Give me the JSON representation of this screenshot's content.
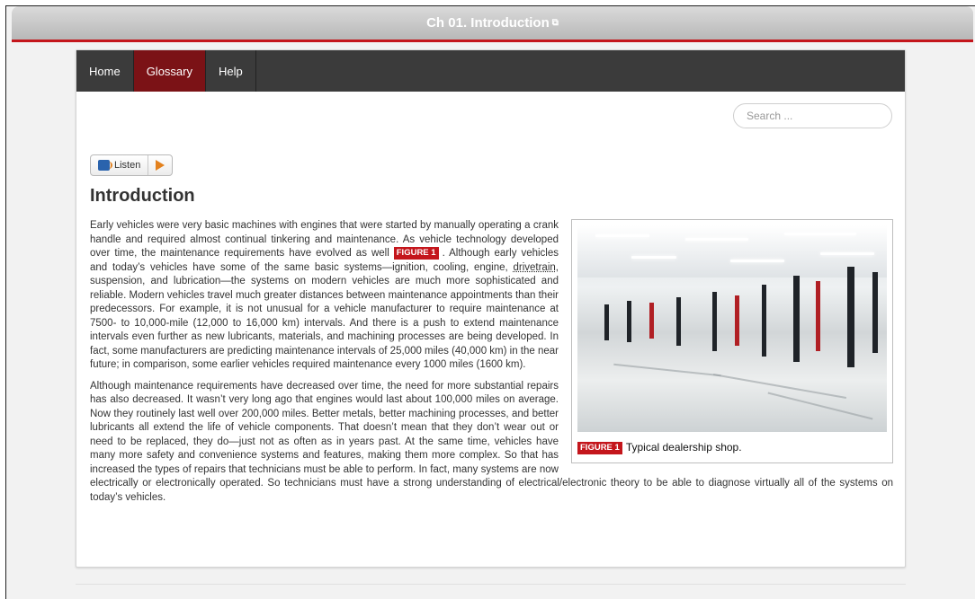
{
  "window": {
    "title": "Ch 01. Introduction",
    "external_link_glyph": "⧉"
  },
  "nav": {
    "items": [
      {
        "label": "Home"
      },
      {
        "label": "Glossary"
      },
      {
        "label": "Help"
      }
    ],
    "active": "Glossary"
  },
  "search": {
    "placeholder": "Search ..."
  },
  "listen": {
    "label": "Listen",
    "play_icon": "play-icon",
    "speaker_icon": "speaker-icon"
  },
  "page": {
    "heading": "Introduction"
  },
  "figure": {
    "badge": "FIGURE 1",
    "caption": "Typical dealership shop.",
    "image_icon": "dealership-shop-photo"
  },
  "body": {
    "p1_a": "Early vehicles were very basic machines with engines that were started by manually operating a crank handle and required almost continual tinkering and maintenance. As vehicle technology developed over time, the maintenance requirements have evolved as well ",
    "p1_badge": "FIGURE 1",
    "p1_b": ". Although early vehicles and today’s vehicles have some of the same basic systems—ignition, cooling, engine, ",
    "p1_term": "drivetrain",
    "p1_c": ", suspension, and lubrication—the systems on modern vehicles are much more sophisticated and reliable. Modern vehicles travel much greater distances between maintenance appointments than their predecessors. For example, it is not unusual for a vehicle manufacturer to require maintenance at 7500- to 10,000-mile (12,000 to 16,000 km) intervals. And there is a push to extend maintenance intervals even further as new lubricants, materials, and machining processes are being developed. In fact, some manufacturers are predicting maintenance intervals of 25,000 miles (40,000 km) in the near future; in comparison, some earlier vehicles required maintenance every 1000 miles (1600 km).",
    "p2": "Although maintenance requirements have decreased over time, the need for more substantial repairs has also decreased. It wasn’t very long ago that engines would last about 100,000 miles on average. Now they routinely last well over 200,000 miles. Better metals, better machining processes, and better lubricants all extend the life of vehicle components. That doesn’t mean that they don’t wear out or need to be replaced, they do—just not as often as in years past. At the same time, vehicles have many more safety and convenience systems and features, making them more complex. So that has increased the types of repairs that technicians must be able to perform. In fact, many systems are now electrically or electronically operated. So technicians must have a strong understanding of electrical/electronic theory to be able to diagnose virtually all of the systems on today’s vehicles."
  },
  "colors": {
    "accent_red": "#c4161c",
    "nav_bg": "#3b3b3b",
    "nav_active": "#7b1216"
  }
}
